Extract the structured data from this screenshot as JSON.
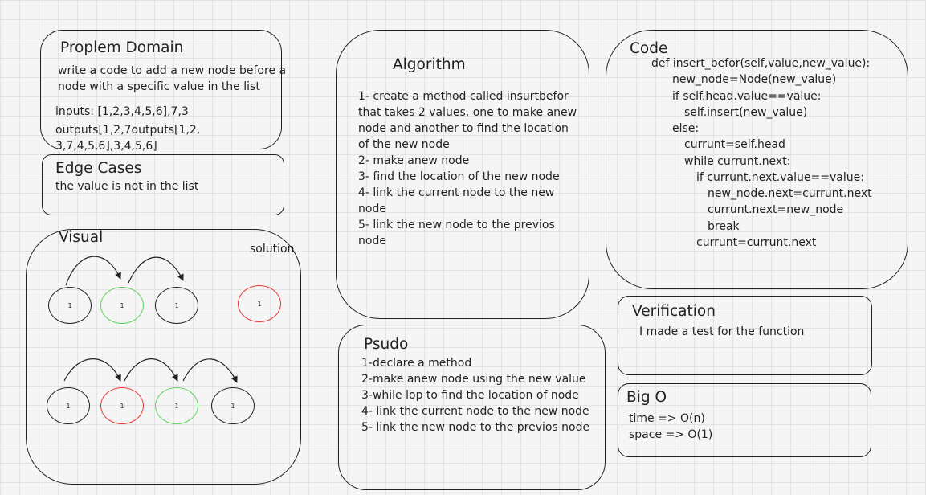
{
  "problem_domain": {
    "title": "Proplem Domain",
    "description": [
      "write a code to add a new node before a",
      "node with a specific value in the list"
    ],
    "inputs": "inputs: [1,2,3,4,5,6],7,3",
    "outputs": [
      "outputs[1,2,7outputs[1,2,",
      "3,7,4,5,6],3,4,5,6]"
    ]
  },
  "edge_cases": {
    "title": "Edge Cases",
    "text": "the value is not in the list"
  },
  "visual": {
    "title": "Visual",
    "solution_label": "solution",
    "node_value": "1",
    "colors": {
      "black": "#222222",
      "green": "#5fd35f",
      "red": "#e53935"
    }
  },
  "algorithm": {
    "title": "Algorithm",
    "lines": [
      "1- create a method called insurtbefor",
      "that takes 2 values, one to make anew",
      "node and another to find the location",
      "of the new node",
      "2- make anew node",
      "3- find the location of the new node",
      "4- link the current node  to the new",
      "node",
      "5- link the new node  to the previos",
      "node"
    ]
  },
  "psudo": {
    "title": "Psudo",
    "lines": [
      "1-declare a method",
      "2-make anew node using the new value",
      "3-while lop to find the location of node",
      "4- link the current node to the new node",
      "5- link the new node  to the previos node"
    ]
  },
  "code": {
    "title": "Code",
    "lines": [
      "def insert_befor(self,value,new_value):",
      "new_node=Node(new_value)",
      "if self.head.value==value:",
      "self.insert(new_value)",
      "else:",
      "currunt=self.head",
      "while currunt.next:",
      "if currunt.next.value==value:",
      "new_node.next=currunt.next",
      "currunt.next=new_node",
      "break",
      "currunt=currunt.next"
    ]
  },
  "verification": {
    "title": "Verification",
    "text": "I made a test for the function"
  },
  "big_o": {
    "title": "Big O",
    "time": "time =>  O(n)",
    "space": "space => O(1)"
  }
}
